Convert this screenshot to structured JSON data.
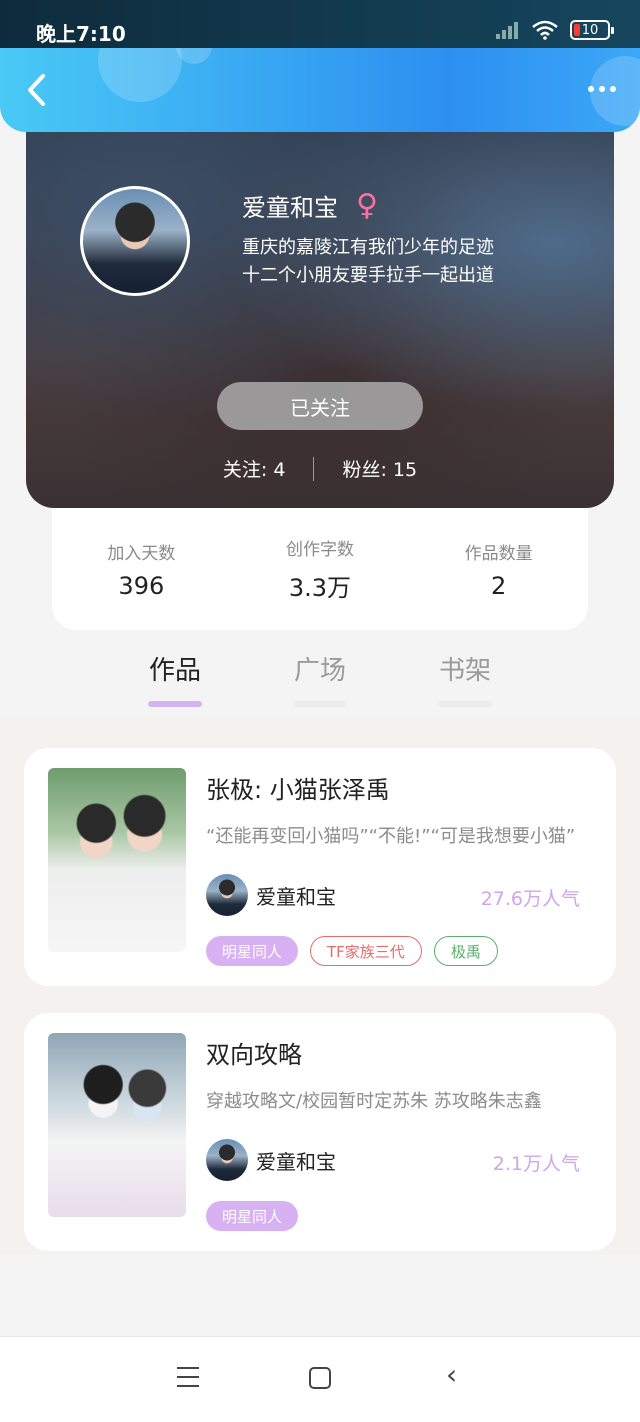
{
  "status_bar": {
    "time": "晚上7:10",
    "battery": "10"
  },
  "profile": {
    "nickname": "爱童和宝",
    "bio_line1": "重庆的嘉陵江有我们少年的足迹",
    "bio_line2": "十二个小朋友要手拉手一起出道",
    "follow_button": "已关注",
    "following_label": "关注: 4",
    "fans_label": "粉丝: 15"
  },
  "stats": [
    {
      "label": "加入天数",
      "value": "396"
    },
    {
      "label": "创作字数",
      "value": "3.3万"
    },
    {
      "label": "作品数量",
      "value": "2"
    }
  ],
  "tabs": [
    {
      "label": "作品",
      "active": true
    },
    {
      "label": "广场",
      "active": false
    },
    {
      "label": "书架",
      "active": false
    }
  ],
  "works": [
    {
      "title": "张极: 小猫张泽禹",
      "description": "“还能再变回小猫吗”“不能!”“可是我想要小猫”",
      "author": "爱童和宝",
      "popularity": "27.6万人气",
      "tags": [
        "明星同人",
        "TF家族三代",
        "极禹"
      ]
    },
    {
      "title": "双向攻略",
      "description": "穿越攻略文/校园暂时定苏朱 苏攻略朱志鑫",
      "author": "爱童和宝",
      "popularity": "2.1万人气",
      "tags": [
        "明星同人"
      ]
    }
  ],
  "colors": {
    "header": "#2d8ff0",
    "accent_purple": "#d2b4f0",
    "tag_red": "#e66b6b",
    "tag_green": "#5ab06a"
  },
  "icons": [
    "back-icon",
    "more-icon",
    "female-icon",
    "menu-icon",
    "home-icon",
    "nav-back-icon"
  ]
}
